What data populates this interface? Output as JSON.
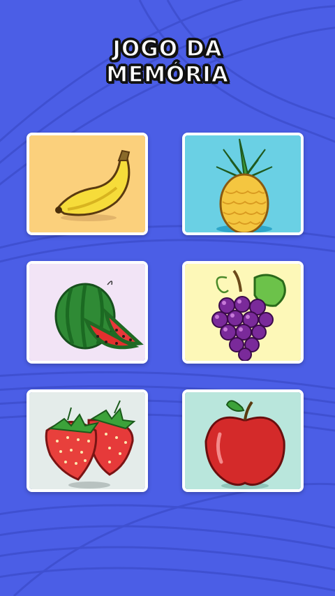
{
  "title": {
    "line1": "JOGO DA",
    "line2": "MEMÓRIA"
  },
  "cards": [
    {
      "fruit": "banana",
      "icon": "banana-icon",
      "bg": "#fbd07c"
    },
    {
      "fruit": "pineapple",
      "icon": "pineapple-icon",
      "bg": "#6ad0e4"
    },
    {
      "fruit": "watermelon",
      "icon": "watermelon-icon",
      "bg": "#f2e4f6"
    },
    {
      "fruit": "grapes",
      "icon": "grapes-icon",
      "bg": "#fdf8b8"
    },
    {
      "fruit": "strawberry",
      "icon": "strawberry-icon",
      "bg": "#e4ecea"
    },
    {
      "fruit": "apple",
      "icon": "apple-icon",
      "bg": "#b9e6dc"
    }
  ],
  "colors": {
    "background": "#4b5ee6",
    "card_border": "#ffffff"
  }
}
